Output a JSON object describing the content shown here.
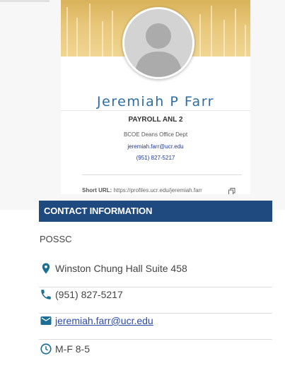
{
  "card": {
    "name": "Jeremiah P Farr",
    "title": "PAYROLL ANL 2",
    "department": "BCOE Deans Office Dept",
    "email": "jeremiah.farr@ucr.edu",
    "phone": "(951) 827-5217",
    "url_label": "Short URL:",
    "url": "https://profiles.ucr.edu/jeremiah.farr"
  },
  "contact": {
    "header": "CONTACT INFORMATION",
    "organization": "POSSC",
    "location": "Winston Chung Hall Suite 458",
    "phone": "(951) 827-5217",
    "email": "jeremiah.farr@ucr.edu",
    "hours": "M-F 8-5"
  },
  "colors": {
    "header_bg": "#1f4a80",
    "name": "#2d6da3",
    "icon": "#1d6e94",
    "link": "#2a4aa8"
  },
  "icons": [
    "location-pin-icon",
    "phone-icon",
    "mail-icon",
    "clock-icon",
    "copy-icon"
  ]
}
